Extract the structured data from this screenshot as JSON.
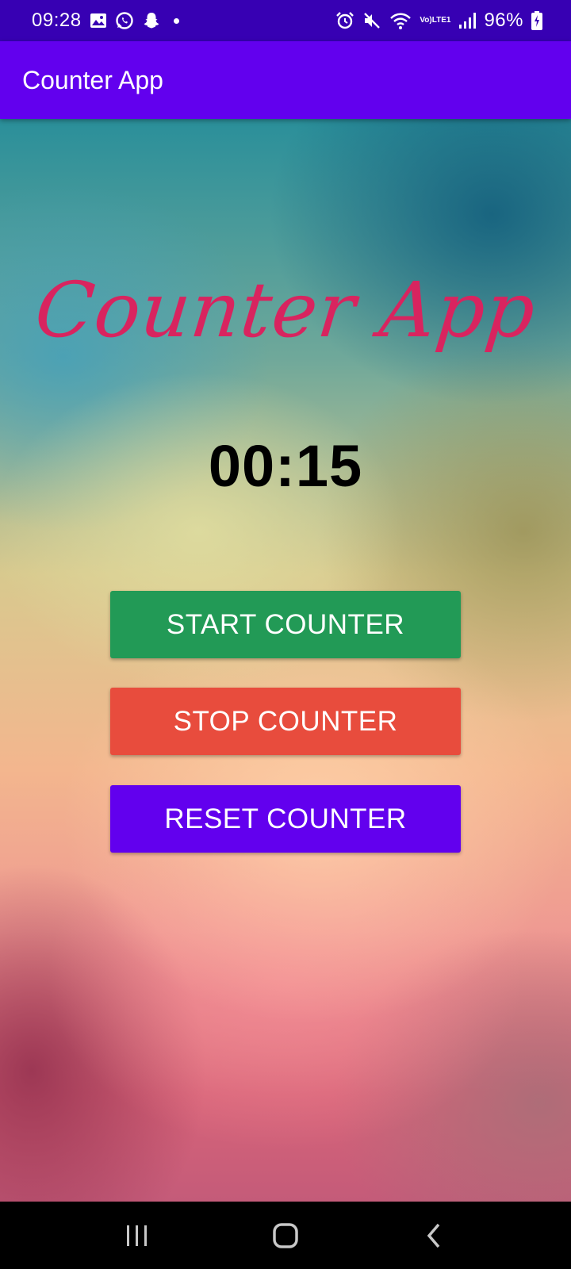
{
  "status_bar": {
    "time": "09:28",
    "battery_percent": "96%",
    "network_label_top": "Vo)",
    "network_label_bottom": "LTE1",
    "notification_icons": [
      "gallery-icon",
      "whatsapp-icon",
      "snapchat-icon",
      "dot-icon"
    ],
    "system_icons": [
      "alarm-icon",
      "mute-icon",
      "wifi-icon",
      "signal-icon",
      "battery-charging-icon"
    ]
  },
  "app_bar": {
    "title": "Counter App"
  },
  "main": {
    "script_title": "Counter App",
    "timer": "00:15",
    "buttons": {
      "start": "START COUNTER",
      "stop": "STOP COUNTER",
      "reset": "RESET COUNTER"
    }
  },
  "colors": {
    "status_bar": "#3700b3",
    "app_bar": "#6200ee",
    "script_title": "#d8245f",
    "start_button": "#229a56",
    "stop_button": "#e84c3d",
    "reset_button": "#6200ee"
  },
  "nav_bar": {
    "icons": [
      "recent-apps-icon",
      "home-icon",
      "back-icon"
    ]
  }
}
